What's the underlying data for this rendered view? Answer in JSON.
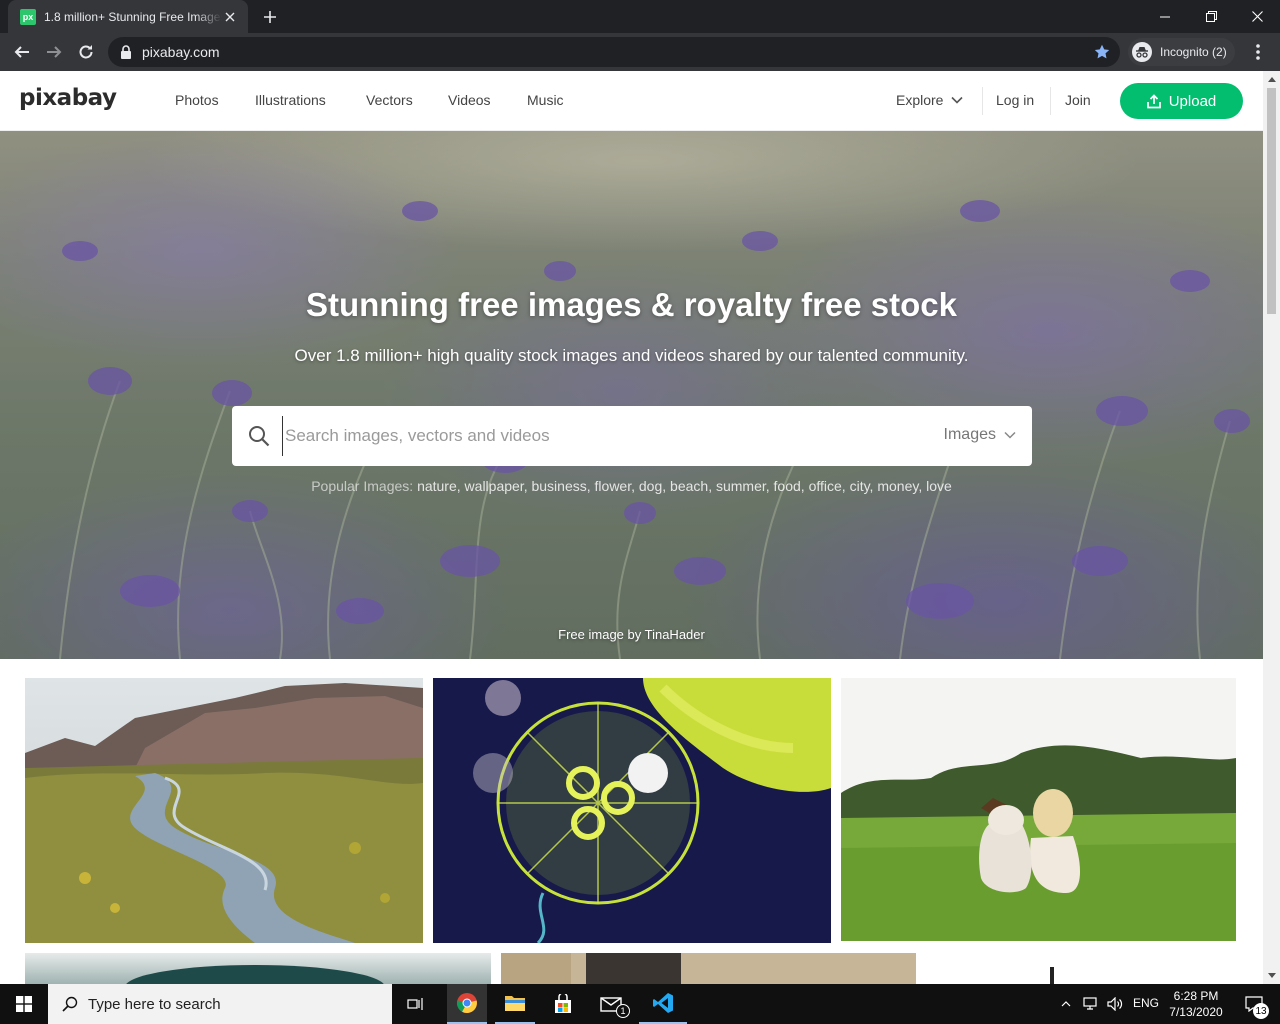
{
  "browser": {
    "tab_title": "1.8 million+ Stunning Free Images",
    "favicon_text": "px",
    "url": "pixabay.com",
    "incognito_label": "Incognito (2)"
  },
  "site": {
    "logo": "pixabay",
    "nav": [
      "Photos",
      "Illustrations",
      "Vectors",
      "Videos",
      "Music"
    ],
    "explore_label": "Explore",
    "login_label": "Log in",
    "join_label": "Join",
    "upload_label": "Upload",
    "accent_color": "#02be6e"
  },
  "hero": {
    "title": "Stunning free images & royalty free stock",
    "subtitle": "Over 1.8 million+ high quality stock images and videos shared by our talented community.",
    "search_placeholder": "Search images, vectors and videos",
    "search_type": "Images",
    "popular_label": "Popular Images:",
    "popular_tags": [
      "nature",
      "wallpaper",
      "business",
      "flower",
      "dog",
      "beach",
      "summer",
      "food",
      "office",
      "city",
      "money",
      "love"
    ],
    "credit": "Free image by TinaHader"
  },
  "taskbar": {
    "search_placeholder": "Type here to search",
    "language": "ENG",
    "time": "6:28 PM",
    "date": "7/13/2020",
    "notification_count": "13",
    "mail_badge": "1"
  }
}
